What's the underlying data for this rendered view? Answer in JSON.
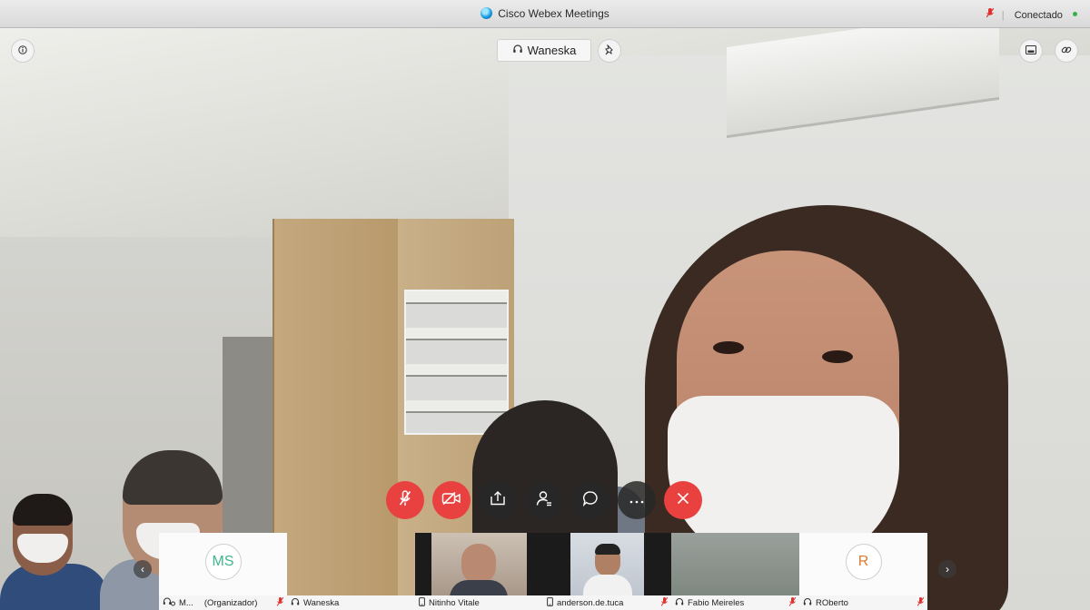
{
  "window": {
    "title": "Cisco Webex Meetings",
    "status": "Conectado"
  },
  "video": {
    "active_speaker": "Waneska"
  },
  "controls": [
    {
      "name": "mute-button",
      "icon": "mic-off-icon"
    },
    {
      "name": "stop-video-button",
      "icon": "video-off-icon"
    },
    {
      "name": "share-button",
      "icon": "share-icon"
    },
    {
      "name": "participants-button",
      "icon": "participants-icon"
    },
    {
      "name": "chat-button",
      "icon": "chat-icon"
    },
    {
      "name": "more-button",
      "icon": "more-icon"
    },
    {
      "name": "leave-button",
      "icon": "close-icon"
    }
  ],
  "participants": [
    {
      "name": "M...",
      "role": "(Organizador)",
      "initials": "MS",
      "device": "headset",
      "muted": true
    },
    {
      "name": "Waneska",
      "role": "",
      "initials": "",
      "device": "headset",
      "muted": false
    },
    {
      "name": "Nitinho Vitale",
      "role": "",
      "initials": "",
      "device": "phone",
      "muted": false
    },
    {
      "name": "anderson.de.tuca",
      "role": "",
      "initials": "",
      "device": "phone",
      "muted": true
    },
    {
      "name": "Fabio Meireles",
      "role": "",
      "initials": "",
      "device": "headset",
      "muted": true
    },
    {
      "name": "ROberto",
      "role": "",
      "initials": "R",
      "device": "headset",
      "muted": true
    }
  ],
  "colors": {
    "danger": "#e8413f",
    "ms_avatar": "#3fb68c",
    "r_avatar": "#e07a2e",
    "connected": "#33b249"
  }
}
